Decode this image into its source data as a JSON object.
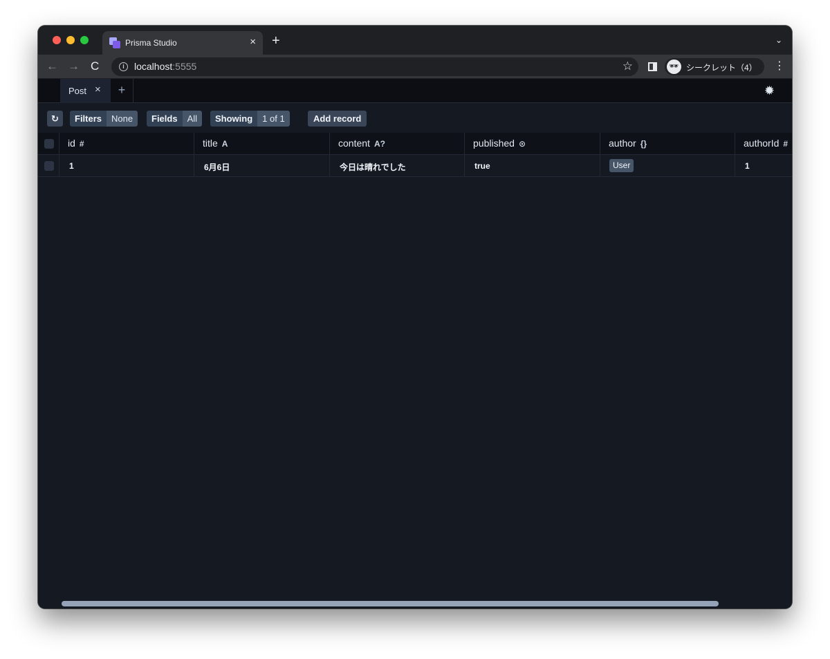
{
  "browser": {
    "tab_title": "Prisma Studio",
    "tab_close": "×",
    "new_tab": "+",
    "tab_menu": "⌄",
    "url_host": "localhost",
    "url_port": ":5555",
    "profile_label": "シークレット（4）",
    "icons": {
      "back": "←",
      "forward": "→",
      "reload": "C",
      "info": "i",
      "star": "☆",
      "incognito": "🕶",
      "menu": "⋮"
    }
  },
  "studio": {
    "tabs": [
      {
        "label": "Post",
        "close": "×"
      }
    ],
    "new_tab": "+",
    "settings_icon": "✹",
    "toolbar": {
      "refresh_icon": "↻",
      "filters_label": "Filters",
      "filters_value": "None",
      "fields_label": "Fields",
      "fields_value": "All",
      "showing_label": "Showing",
      "showing_value": "1 of 1",
      "add_record": "Add record"
    },
    "table": {
      "columns": [
        {
          "name": "id",
          "type": "#"
        },
        {
          "name": "title",
          "type": "A"
        },
        {
          "name": "content",
          "type": "A?"
        },
        {
          "name": "published",
          "type": "⊙"
        },
        {
          "name": "author",
          "type": "{}"
        },
        {
          "name": "authorId",
          "type": "#"
        }
      ],
      "rows": [
        {
          "id": "1",
          "title": "6月6日",
          "content": "今日は晴れでした",
          "published": "true",
          "author": "User",
          "authorId": "1"
        }
      ]
    }
  }
}
